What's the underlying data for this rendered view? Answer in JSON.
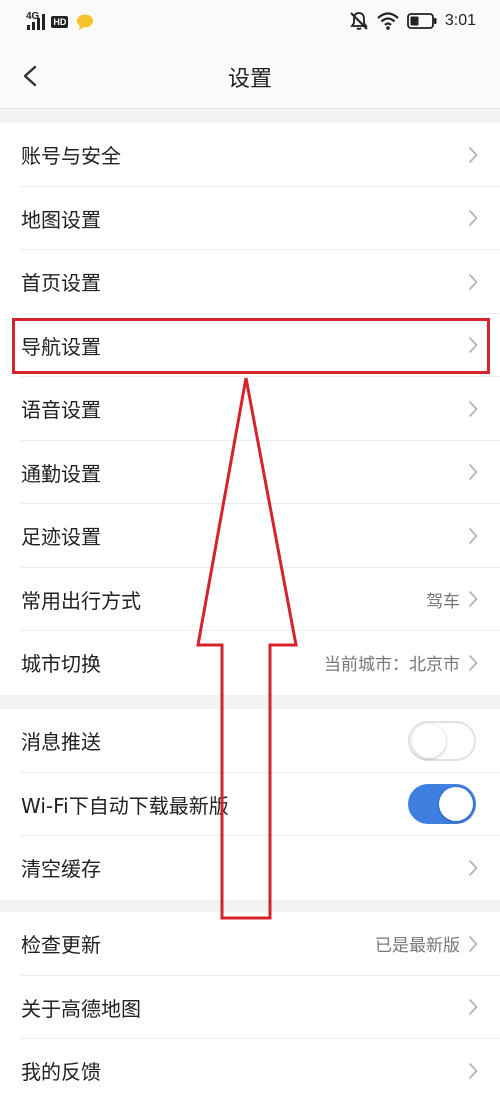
{
  "status_bar": {
    "network": "4G",
    "hd": "HD",
    "time": "3:01"
  },
  "header": {
    "title": "设置"
  },
  "groups": [
    {
      "items": [
        {
          "label": "账号与安全",
          "value": ""
        },
        {
          "label": "地图设置",
          "value": ""
        },
        {
          "label": "首页设置",
          "value": ""
        },
        {
          "label": "导航设置",
          "value": ""
        },
        {
          "label": "语音设置",
          "value": ""
        },
        {
          "label": "通勤设置",
          "value": ""
        },
        {
          "label": "足迹设置",
          "value": ""
        },
        {
          "label": "常用出行方式",
          "value": "驾车"
        },
        {
          "label": "城市切换",
          "value": "当前城市：北京市"
        }
      ]
    },
    {
      "items": [
        {
          "label": "消息推送",
          "toggle": "off"
        },
        {
          "label": "Wi-Fi下自动下载最新版",
          "toggle": "on"
        },
        {
          "label": "清空缓存",
          "value": ""
        }
      ]
    },
    {
      "items": [
        {
          "label": "检查更新",
          "value": "已是最新版"
        },
        {
          "label": "关于高德地图",
          "value": ""
        },
        {
          "label": "我的反馈",
          "value": ""
        }
      ]
    }
  ],
  "colors": {
    "accent": "#3e7fe0",
    "annotation": "#d4232c",
    "background": "#f3f3f3"
  },
  "icons": {
    "back": "chevron-left-icon",
    "row_arrow": "chevron-right-icon"
  }
}
